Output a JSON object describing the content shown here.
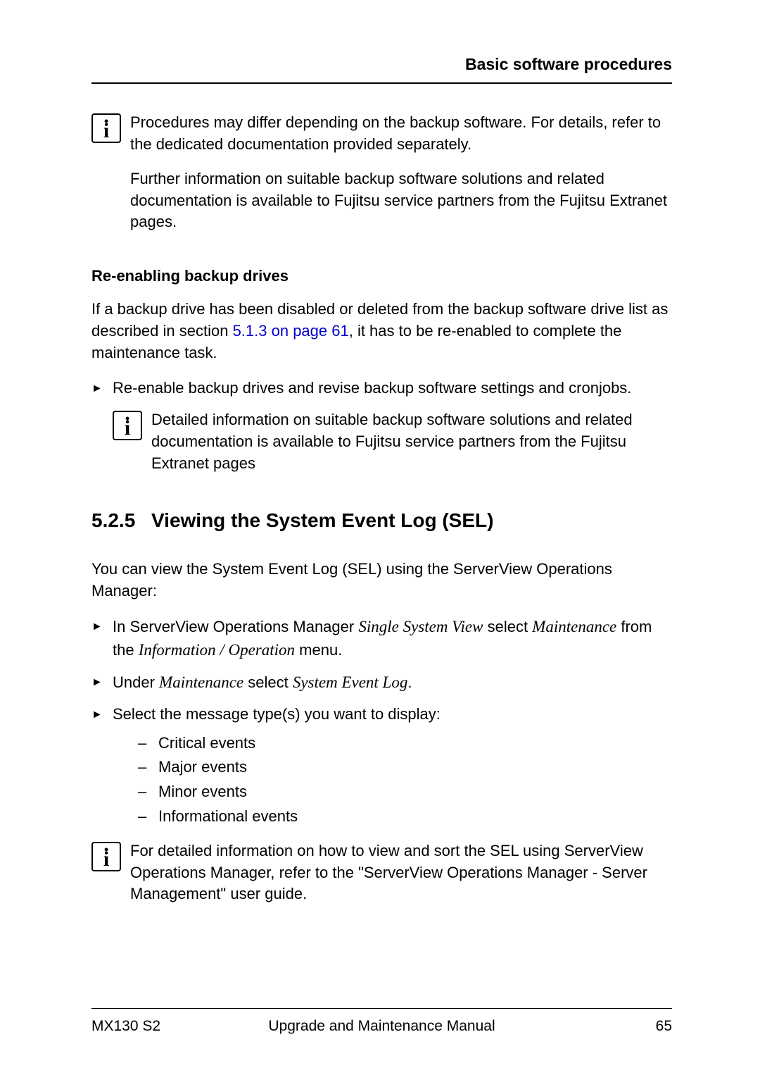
{
  "header": {
    "title": "Basic software procedures"
  },
  "note1": {
    "p1": "Procedures may differ depending on the backup software. For details, refer to the dedicated documentation provided separately.",
    "p2": "Further information on suitable backup software solutions and related documentation is available to Fujitsu service partners from the Fujitsu Extranet pages."
  },
  "subheading1": "Re-enabling backup drives",
  "para1_pre": "If a backup drive has been disabled or deleted from the backup software drive list as described in section ",
  "para1_link": "5.1.3 on page 61",
  "para1_post": ", it has to be re-enabled to complete the maintenance task.",
  "action1": "Re-enable backup drives and revise backup software settings and cronjobs.",
  "note2": "Detailed information on suitable backup software solutions and related documentation is available to Fujitsu service partners from the Fujitsu Extranet pages",
  "section": {
    "number": "5.2.5",
    "title": "Viewing the System Event Log (SEL)"
  },
  "para2": "You can view the System Event Log (SEL) using the ServerView Operations Manager:",
  "action2_pre": "In ServerView Operations Manager ",
  "action2_em1": "Single System View",
  "action2_mid": " select ",
  "action2_em2": "Maintenance",
  "action2_mid2": " from the ",
  "action2_em3": "Information / Operation",
  "action2_post": " menu.",
  "action3_pre": "Under ",
  "action3_em1": "Maintenance",
  "action3_mid": " select ",
  "action3_em2": "System Event Log",
  "action3_post": ".",
  "action4": "Select the message type(s) you want to display:",
  "sublist": {
    "item1": "Critical events",
    "item2": "Major events",
    "item3": "Minor events",
    "item4": "Informational events"
  },
  "note3": "For detailed information on how to view and sort the SEL using ServerView Operations Manager, refer to the \"ServerView Operations Manager - Server Management\" user guide.",
  "footer": {
    "left": "MX130 S2",
    "center": "Upgrade and Maintenance Manual",
    "right": "65"
  }
}
